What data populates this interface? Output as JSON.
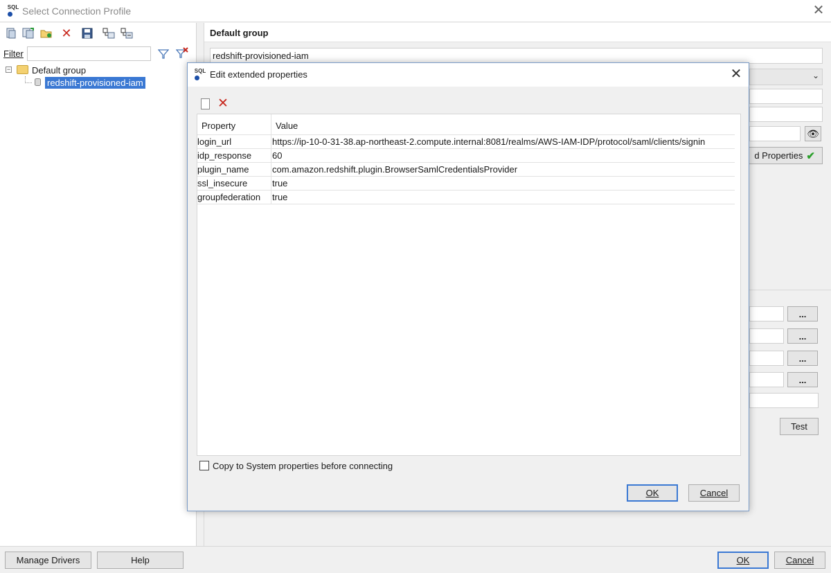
{
  "window": {
    "title": "Select Connection Profile",
    "close": "✕"
  },
  "left_pane": {
    "filter_label": "Filter",
    "filter_value": "",
    "tree": {
      "group": "Default group",
      "profile": "redshift-provisioned-iam"
    }
  },
  "right_pane": {
    "group_title": "Default group",
    "profile_name": "redshift-provisioned-iam",
    "extended_properties_button": "d Properties",
    "test_button": "Test",
    "browse_button": "..."
  },
  "bottom_bar": {
    "manage_drivers": "Manage Drivers",
    "help": "Help",
    "ok": "OK",
    "cancel": "Cancel"
  },
  "dialog": {
    "title": "Edit extended properties",
    "close": "✕",
    "columns": [
      "Property",
      "Value"
    ],
    "rows": [
      {
        "property": "login_url",
        "value": "https://ip-10-0-31-38.ap-northeast-2.compute.internal:8081/realms/AWS-IAM-IDP/protocol/saml/clients/signin"
      },
      {
        "property": "idp_response",
        "value": "60"
      },
      {
        "property": "plugin_name",
        "value": "com.amazon.redshift.plugin.BrowserSamlCredentialsProvider"
      },
      {
        "property": "ssl_insecure",
        "value": "true"
      },
      {
        "property": "groupfederation",
        "value": "true"
      }
    ],
    "copy_to_system_label": "Copy to System properties before connecting",
    "copy_to_system_checked": false,
    "ok": "OK",
    "cancel": "Cancel"
  },
  "colors": {
    "selection": "#3a78d3",
    "delete_icon": "#c8281e",
    "check_icon": "#2ca02c"
  },
  "icons": [
    "sql-app-icon",
    "new-profile-icon",
    "copy-profile-icon",
    "new-folder-icon",
    "delete-icon",
    "save-icon",
    "expand-icon",
    "collapse-icon",
    "filter-icon",
    "clear-filter-icon",
    "folder-icon",
    "database-icon",
    "eye-icon",
    "checkmark-icon",
    "new-property-icon"
  ]
}
